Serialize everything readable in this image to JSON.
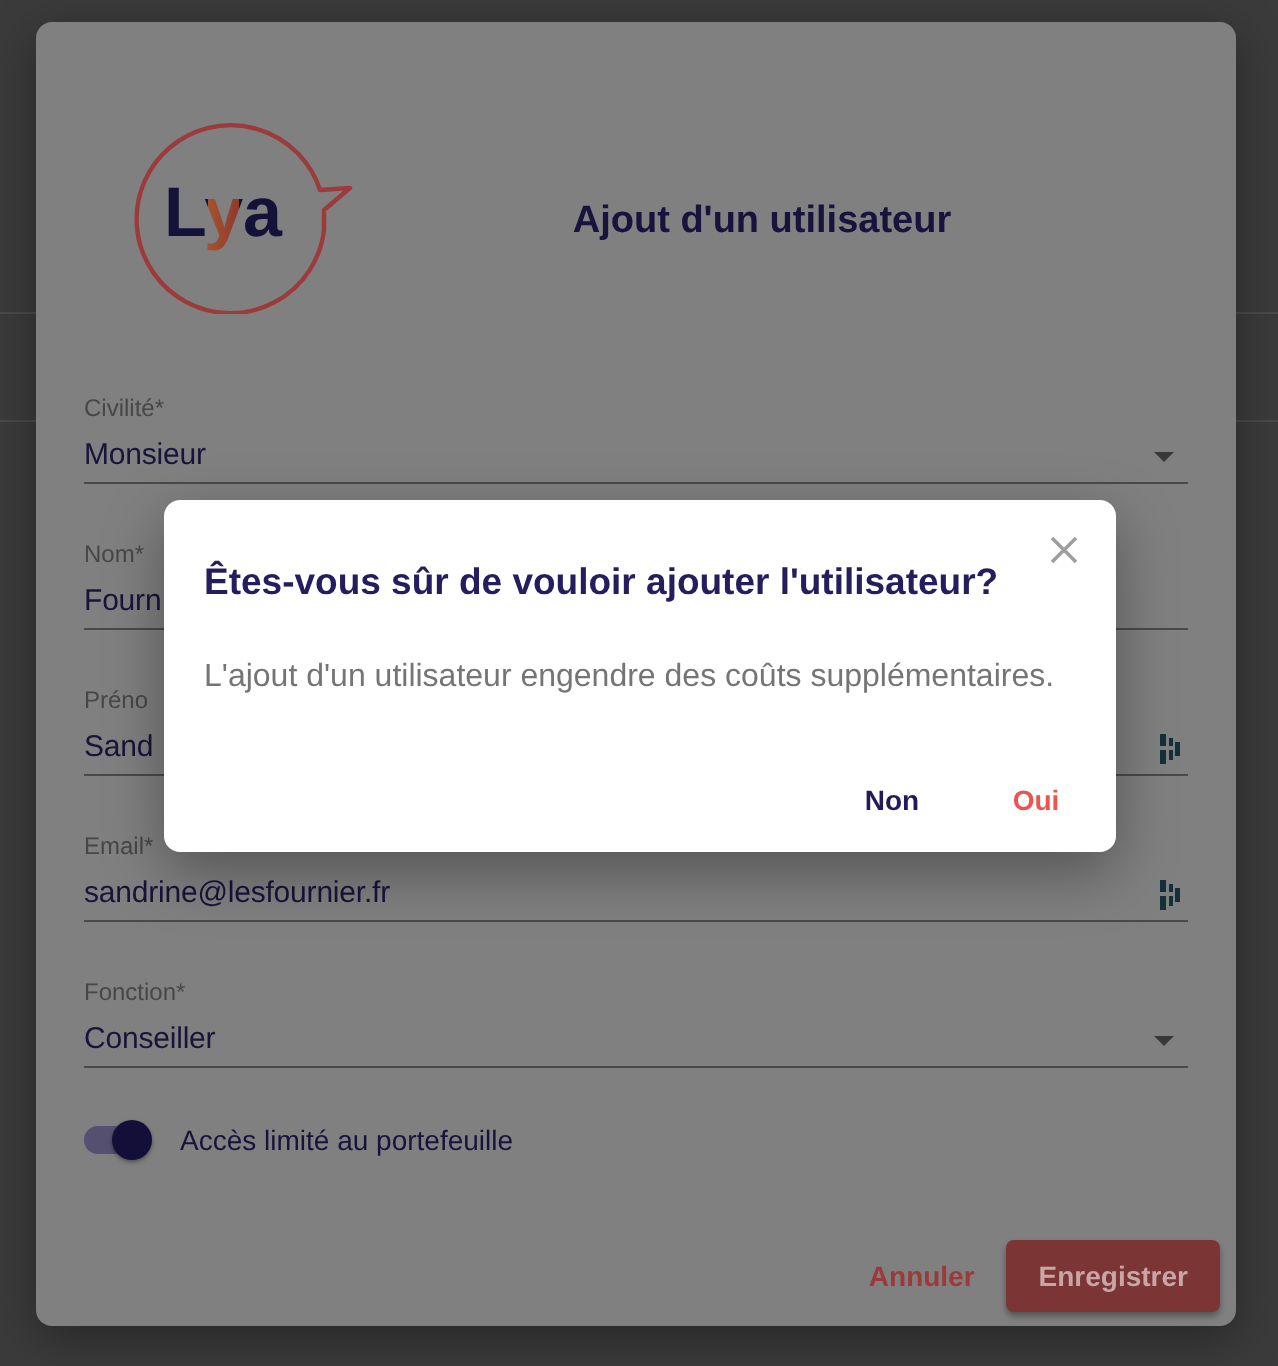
{
  "form_dialog": {
    "logo": {
      "text": "Lya"
    },
    "title": "Ajout d'un utilisateur",
    "fields": [
      {
        "kind": "select",
        "label": "Civilité*",
        "value": "Monsieur",
        "autofill": false
      },
      {
        "kind": "text",
        "label": "Nom*",
        "value": "Fourn",
        "autofill": false
      },
      {
        "kind": "text",
        "label": "Préno",
        "value": "Sand",
        "autofill": true
      },
      {
        "kind": "text",
        "label": "Email*",
        "value": "sandrine@lesfournier.fr",
        "autofill": true
      },
      {
        "kind": "select",
        "label": "Fonction*",
        "value": "Conseiller",
        "autofill": false
      }
    ],
    "toggle": {
      "label": "Accès limité au portefeuille",
      "on": true
    },
    "buttons": [
      {
        "kind": "text",
        "label": "Annuler"
      },
      {
        "kind": "raised",
        "label": "Enregistrer"
      }
    ]
  },
  "confirm_dialog": {
    "title": "Êtes-vous sûr de vouloir ajouter l'utilisateur?",
    "message": "L'ajout d'un utilisateur engendre des coûts supplémentaires.",
    "buttons": [
      {
        "kind": "neutral",
        "label": "Non"
      },
      {
        "kind": "accent",
        "label": "Oui"
      }
    ]
  }
}
